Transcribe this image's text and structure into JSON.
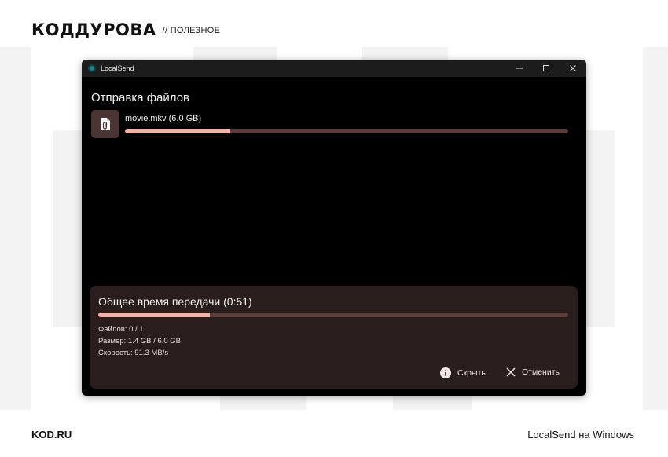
{
  "brand": {
    "logo": "КОДДУРОВА",
    "section": "// ПОЛЕЗНОЕ"
  },
  "footer": {
    "site": "KOD.RU",
    "caption": "LocalSend на Windows"
  },
  "window": {
    "title": "LocalSend",
    "controls": [
      "minimize-icon",
      "maximize-icon",
      "close-icon"
    ],
    "page_title": "Отправка файлов",
    "file": {
      "name": "movie.mkv (6.0 GB)",
      "icon": "attachment-icon",
      "progress": 0.238
    },
    "summary": {
      "title": "Общее время передачи (0:51)",
      "progress": 0.238,
      "files": "Файлов: 0 / 1",
      "size": "Размер: 1.4 GB / 6.0 GB",
      "speed": "Скорость: 91.3 MB/s"
    },
    "actions": {
      "hide_label": "Скрыть",
      "hide_icon": "info-icon",
      "cancel_label": "Отменить",
      "cancel_icon": "close-icon"
    }
  },
  "colors": {
    "accent": "#f4b2a8",
    "track": "#5a3e3b",
    "panel": "#2a1e1d",
    "window_bg": "#000000",
    "titlebar": "#1c1c1c"
  }
}
